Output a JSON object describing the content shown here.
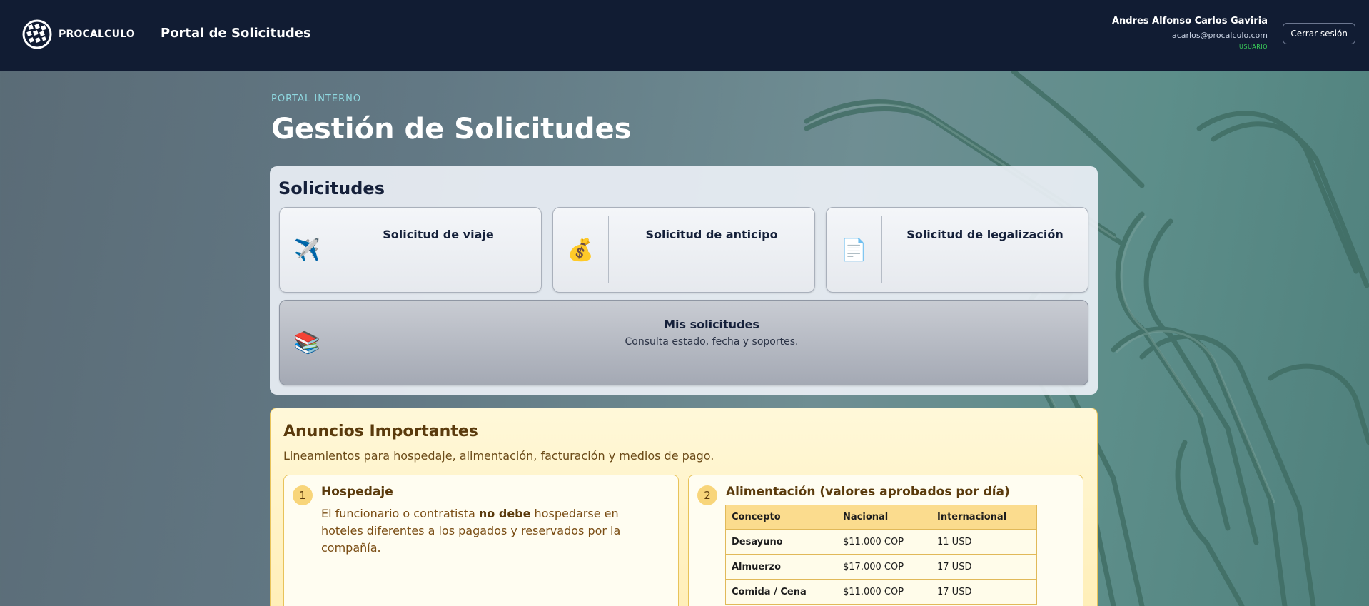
{
  "header": {
    "brand": "PROCALCULO",
    "app_title": "Portal de Solicitudes",
    "user": {
      "name": "Andres Alfonso Carlos Gaviria",
      "email": "acarlos@procalculo.com",
      "role": "USUARIO"
    },
    "logout_label": "Cerrar sesión"
  },
  "hero": {
    "kicker": "PORTAL INTERNO",
    "title": "Gestión de Solicitudes"
  },
  "solicitudes": {
    "title": "Solicitudes",
    "cards": [
      {
        "icon": "airplane-icon",
        "glyph": "✈️",
        "label": "Solicitud de viaje"
      },
      {
        "icon": "money-bag-icon",
        "glyph": "💰",
        "label": "Solicitud de anticipo"
      },
      {
        "icon": "document-icon",
        "glyph": "📄",
        "label": "Solicitud de legalización"
      }
    ],
    "mis": {
      "icon": "books-icon",
      "glyph": "📚",
      "label": "Mis solicitudes",
      "subtitle": "Consulta estado, fecha y soportes."
    }
  },
  "anuncios": {
    "title": "Anuncios Importantes",
    "subtitle": "Lineamientos para hospedaje, alimentación, facturación y medios de pago.",
    "items": [
      {
        "number": "1",
        "heading": "Hospedaje",
        "text_before": "El funcionario o contratista ",
        "text_bold": "no debe",
        "text_after": " hospedarse en hoteles diferentes a los pagados y reservados por la compañía."
      },
      {
        "number": "2",
        "heading": "Alimentación (valores aprobados por día)",
        "table": {
          "headers": [
            "Concepto",
            "Nacional",
            "Internacional"
          ],
          "rows": [
            [
              "Desayuno",
              "$11.000 COP",
              "11 USD"
            ],
            [
              "Almuerzo",
              "$17.000 COP",
              "17 USD"
            ],
            [
              "Comida / Cena",
              "$11.000 COP",
              "17 USD"
            ]
          ]
        }
      }
    ]
  },
  "colors": {
    "header_bg": "#111c33",
    "role_badge": "#3ad35a",
    "announce_bg": "#fff4cc",
    "announce_border": "#e8c35a"
  }
}
